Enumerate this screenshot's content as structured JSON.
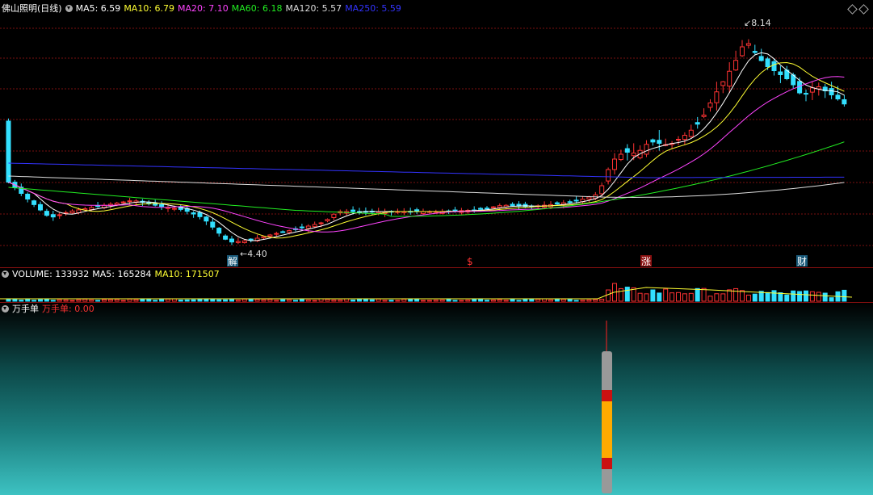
{
  "main": {
    "title": "佛山照明(日线)",
    "ma_legend": [
      {
        "label": "MA5: 6.59",
        "color": "#ffffff"
      },
      {
        "label": "MA10: 6.79",
        "color": "#ffff33"
      },
      {
        "label": "MA20: 7.10",
        "color": "#ff44ff"
      },
      {
        "label": "MA60: 6.18",
        "color": "#22ee22"
      },
      {
        "label": "MA120: 5.57",
        "color": "#dddddd"
      },
      {
        "label": "MA250: 5.59",
        "color": "#3333ff"
      }
    ],
    "high_label": "8.14",
    "low_label": "4.40",
    "markers": [
      {
        "text": "解",
        "color": "#ffffff",
        "bg": "#1a5a7a"
      },
      {
        "text": "$",
        "color": "#ff3333",
        "bg": ""
      },
      {
        "text": "涨",
        "color": "#ffffff",
        "bg": "#8a1010"
      },
      {
        "text": "财",
        "color": "#ffffff",
        "bg": "#1a5a7a"
      }
    ],
    "colors": {
      "up": "#ff3333",
      "down": "#33e0ff",
      "grid": "#7a1010"
    }
  },
  "volume": {
    "label": "VOLUME: 133932",
    "ma5": "MA5: 165284",
    "ma10": "MA10: 171507"
  },
  "wanshou": {
    "title": "万手单",
    "value_label": "万手单: 0.00"
  }
}
